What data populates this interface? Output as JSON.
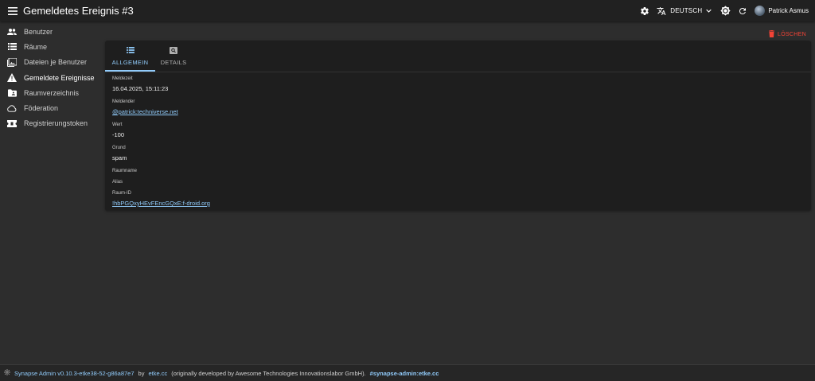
{
  "app": {
    "title": "Gemeldetes Ereignis #3",
    "language": "DEUTSCH",
    "user_name": "Patrick Asmus"
  },
  "sidebar": {
    "items": [
      {
        "label": "Benutzer",
        "icon": "users-icon"
      },
      {
        "label": "Räume",
        "icon": "list-icon"
      },
      {
        "label": "Dateien je Benutzer",
        "icon": "photo-library-icon"
      },
      {
        "label": "Gemeldete Ereignisse",
        "icon": "warning-icon"
      },
      {
        "label": "Raumverzeichnis",
        "icon": "folder-shared-icon"
      },
      {
        "label": "Föderation",
        "icon": "cloud-icon"
      },
      {
        "label": "Registrierungstoken",
        "icon": "ticket-icon"
      }
    ]
  },
  "actions": {
    "delete_label": "LÖSCHEN"
  },
  "tabs": [
    {
      "label": "ALLGEMEIN",
      "active": true
    },
    {
      "label": "DETAILS",
      "active": false
    }
  ],
  "report": {
    "received_label": "Meldezeit",
    "received_value": "16.04.2025, 15:11:23",
    "reporter_label": "Meldender",
    "reporter_value": "@patrick:techniverse.net",
    "score_label": "Wert",
    "score_value": "-100",
    "reason_label": "Grund",
    "reason_value": "spam",
    "room_name_label": "Raumname",
    "alias_label": "Alias",
    "room_id_label": "Raum-ID",
    "room_id_value": "!hbPGQxyHEvFEncGQxE:f-droid.org"
  },
  "footer": {
    "version": "Synapse Admin v0.10.3-etke38-52-g86a87e7",
    "by": "by",
    "etke": "etke.cc",
    "original": "(originally developed by Awesome Technologies Innovationslabor GmbH).",
    "channel": "#synapse-admin:etke.cc"
  },
  "colors": {
    "accent": "#90caf9",
    "danger": "#f44336",
    "appbar": "#212121",
    "background": "#2d2d2d",
    "card": "#1e1e1e"
  }
}
